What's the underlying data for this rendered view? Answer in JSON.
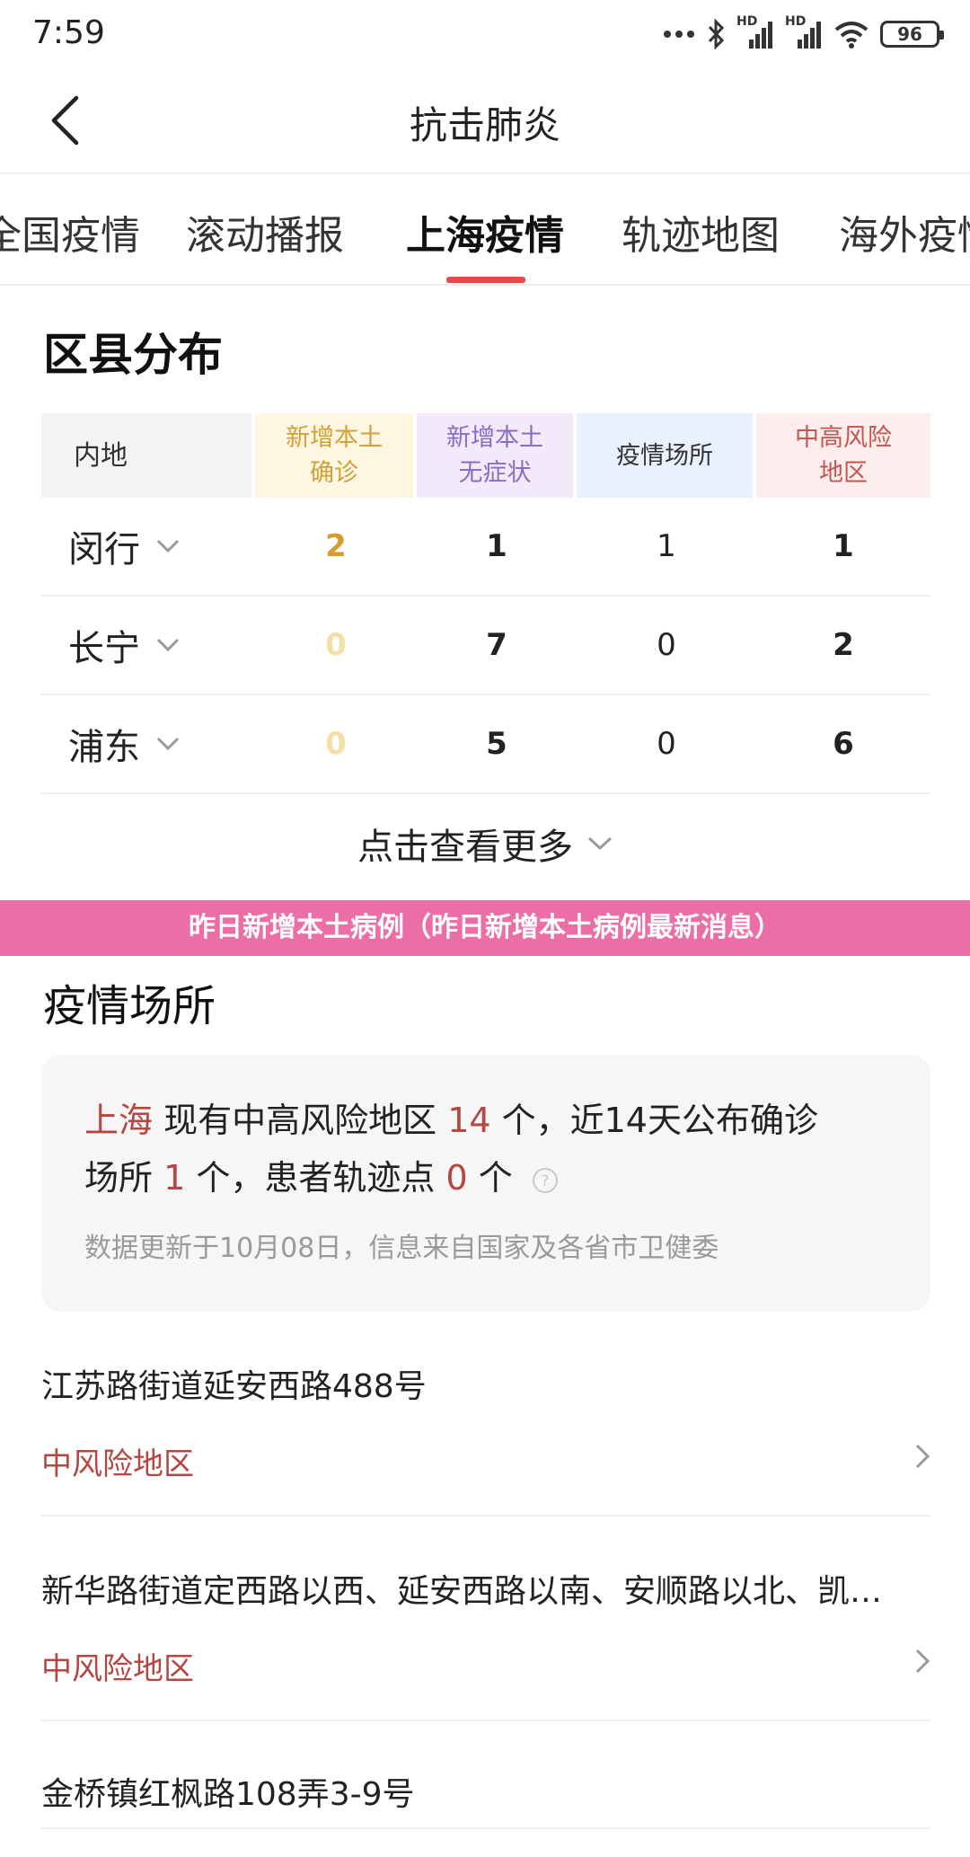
{
  "status_bar": {
    "time": "7:59",
    "battery": "96",
    "signal_label_1": "HD",
    "signal_label_2": "HD"
  },
  "header": {
    "title": "抗击肺炎"
  },
  "tabs": [
    {
      "label": "全国疫情",
      "active": false
    },
    {
      "label": "滚动播报",
      "active": false
    },
    {
      "label": "上海疫情",
      "active": true
    },
    {
      "label": "轨迹地图",
      "active": false
    },
    {
      "label": "海外疫情",
      "active": false
    }
  ],
  "district": {
    "title": "区县分布",
    "headers": [
      "内地",
      "新增本土\n确诊",
      "新增本土\n无症状",
      "疫情场所",
      "中高风险\n地区"
    ],
    "rows": [
      {
        "name": "闵行",
        "confirmed": "2",
        "asymptomatic": "1",
        "venues": "1",
        "risk_areas": "1"
      },
      {
        "name": "长宁",
        "confirmed": "0",
        "asymptomatic": "7",
        "venues": "0",
        "risk_areas": "2"
      },
      {
        "name": "浦东",
        "confirmed": "0",
        "asymptomatic": "5",
        "venues": "0",
        "risk_areas": "6"
      }
    ],
    "more_label": "点击查看更多"
  },
  "banner": {
    "text": "昨日新增本土病例（昨日新增本土病例最新消息）"
  },
  "venues": {
    "title": "疫情场所",
    "summary": {
      "city": "上海",
      "text_1": " 现有中高风险地区 ",
      "risk_count": "14",
      "text_2": " 个，近14天公布确诊",
      "text_3": "场所 ",
      "venue_count": "1",
      "text_4": " 个，患者轨迹点 ",
      "track_count": "0",
      "text_5": " 个"
    },
    "note": "数据更新于10月08日，信息来自国家及各省市卫健委",
    "items": [
      {
        "name": "江苏路街道延安西路488号",
        "risk": "中风险地区"
      },
      {
        "name": "新华路街道定西路以西、延安西路以南、安顺路以北、凯…",
        "risk": "中风险地区"
      },
      {
        "name": "金桥镇红枫路108弄3-9号",
        "risk": ""
      }
    ]
  },
  "colors": {
    "accent": "#e8474c",
    "banner": "#ec6ea6",
    "risk_red": "#b54641",
    "confirmed_gold": "#d59d2c"
  }
}
